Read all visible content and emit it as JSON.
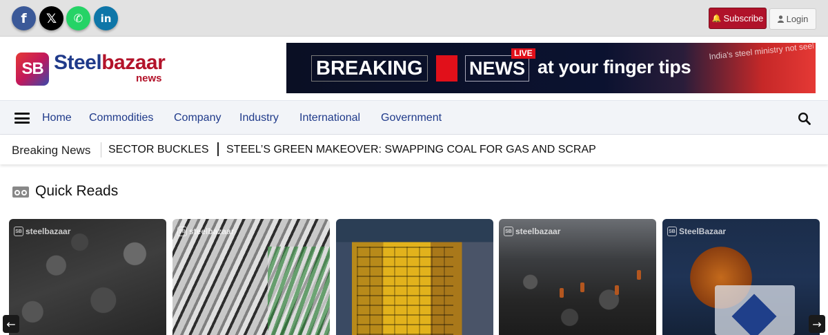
{
  "social": {
    "facebook": "f",
    "twitter": "𝕏",
    "whatsapp": "✆",
    "linkedin": "in"
  },
  "header": {
    "subscribe_label": "Subscribe",
    "login_label": "Login"
  },
  "logo": {
    "badge": "SB",
    "steel": "Steel",
    "bazaar": "bazaar",
    "news": "news"
  },
  "banner": {
    "breaking": "BREAKING",
    "news": "NEWS",
    "live": "LIVE",
    "tagline": "at your finger tips",
    "headline_snippet": "India's steel ministry not seeking higher import taxes"
  },
  "nav": {
    "items": [
      "Home",
      "Commodities",
      "Company",
      "Industry",
      "International",
      "Government"
    ]
  },
  "ticker": {
    "label": "Breaking News",
    "items": [
      "SECTOR BUCKLES",
      "STEEL’S GREEN MAKEOVER: SWAPPING COAL FOR GAS AND SCRAP"
    ]
  },
  "quick_reads": {
    "title": "Quick Reads",
    "cards": [
      {
        "watermark": "steelbazaar"
      },
      {
        "watermark": "steelbazaar"
      },
      {
        "watermark": ""
      },
      {
        "watermark": "steelbazaar"
      },
      {
        "watermark": "SteelBazaar"
      }
    ]
  },
  "arrows": {
    "prev": "←",
    "next": "→"
  },
  "colors": {
    "brand_blue": "#1f3a8a",
    "brand_red": "#b3132a",
    "subscribe_bg": "#b0122a"
  }
}
